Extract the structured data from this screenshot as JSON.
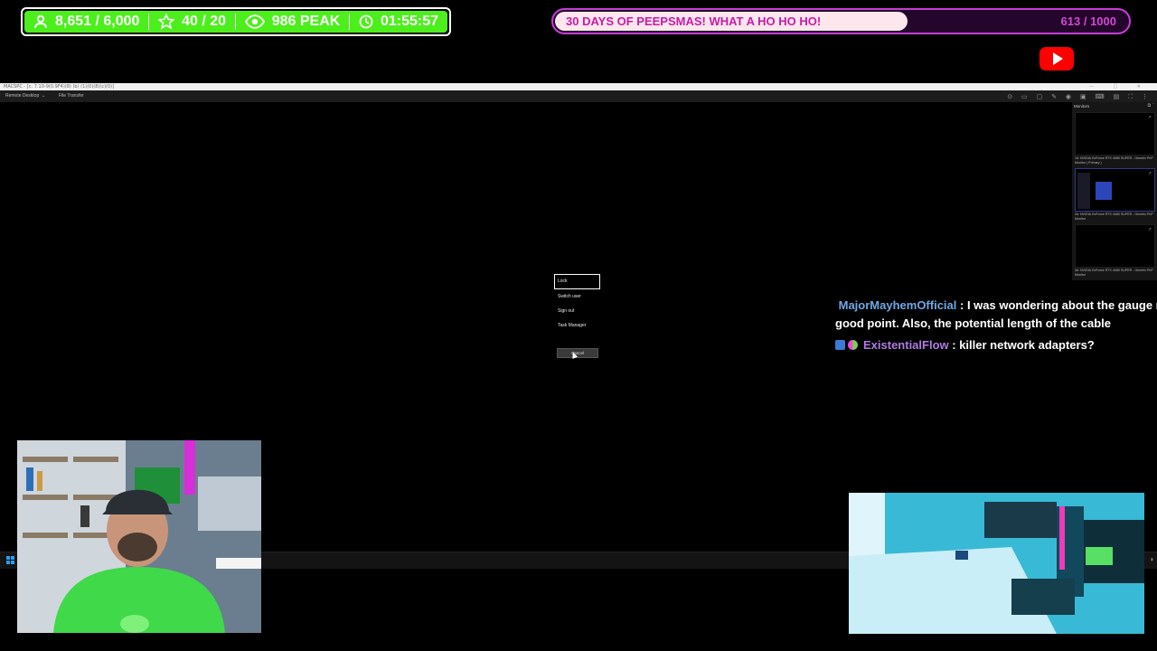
{
  "stream_stats": {
    "followers": "8,651 / 6,000",
    "subs": "40 / 20",
    "peak": "986 PEAK",
    "uptime": "01:55:57",
    "bar_color": "#4cef1c"
  },
  "goal": {
    "title": "30 DAYS OF PEEPSMAS! WHAT A HO HO HO!",
    "count": "613 / 1000",
    "progress": 0.613,
    "accent": "#c63ed7"
  },
  "youtube_icon": "youtube-icon",
  "remote_app": {
    "title": "MACSPC - [c: 7.10-9(0.9F4)(8) (b) (1)(0)(8)(c)(0)]",
    "tabs": [
      "Remote Desktop",
      "File Transfer"
    ],
    "toolbar_icons": [
      "refresh-icon",
      "display-icon",
      "chat-icon",
      "pen-icon",
      "record-icon",
      "monitor-icon",
      "keyboard-icon",
      "window-icon",
      "fullscreen-icon",
      "more-icon"
    ]
  },
  "monitors_panel": {
    "title": "Monitors",
    "items": [
      {
        "label": "1#: NVIDIA GeForce RTX 4080 SUPER - Generic PnP Monitor ( Primary )"
      },
      {
        "label": "2#: NVIDIA GeForce RTX 4080 SUPER - Generic PnP Monitor"
      },
      {
        "label": "3#: NVIDIA GeForce RTX 4080 SUPER - Generic PnP Monitor"
      }
    ]
  },
  "ctrl_alt_del_menu": {
    "items": [
      "Lock",
      "Switch user",
      "Sign out",
      "Task Manager"
    ],
    "selected": "Lock",
    "cancel": "Cancel"
  },
  "chat": {
    "messages": [
      {
        "user": "MajorMayhemOfficial",
        "text_line1": " : I was wondering about the gauge n",
        "text_line2": "good point. Also, the potential length of the cable"
      },
      {
        "user": "ExistentialFlow",
        "text_line1": " : killer network adapters?"
      }
    ]
  }
}
